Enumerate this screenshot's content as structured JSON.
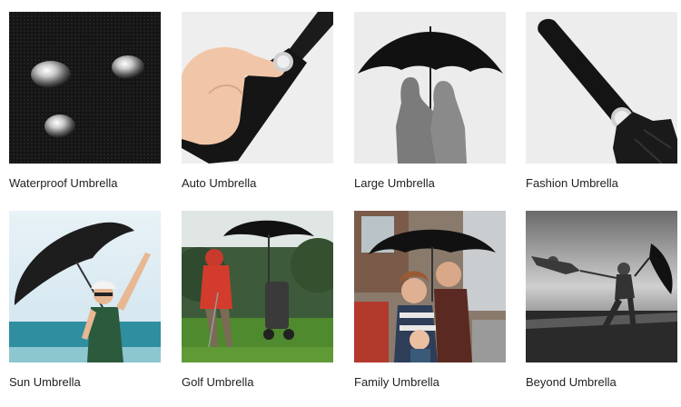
{
  "products": [
    {
      "label": "Waterproof Umbrella",
      "image": "fabric-water-drops-image"
    },
    {
      "label": "Auto Umbrella",
      "image": "hand-pressing-auto-button-image"
    },
    {
      "label": "Large Umbrella",
      "image": "couple-under-large-umbrella-image"
    },
    {
      "label": "Fashion Umbrella",
      "image": "folded-umbrella-handle-image"
    },
    {
      "label": "Sun Umbrella",
      "image": "woman-on-beach-with-umbrella-image"
    },
    {
      "label": "Golf Umbrella",
      "image": "golfer-with-umbrella-image"
    },
    {
      "label": "Family Umbrella",
      "image": "family-under-umbrella-image"
    },
    {
      "label": "Beyond Umbrella",
      "image": "windblown-umbrella-storm-image"
    }
  ]
}
